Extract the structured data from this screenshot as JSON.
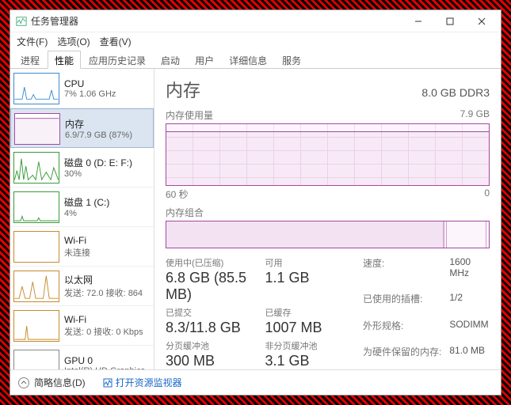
{
  "window": {
    "title": "任务管理器"
  },
  "menu": {
    "file": "文件(F)",
    "options": "选项(O)",
    "view": "查看(V)"
  },
  "tabs": {
    "processes": "进程",
    "performance": "性能",
    "app_history": "应用历史记录",
    "startup": "启动",
    "users": "用户",
    "details": "详细信息",
    "services": "服务"
  },
  "sidebar": {
    "items": [
      {
        "name": "CPU",
        "sub": "7%  1.06 GHz",
        "kind": "cpu"
      },
      {
        "name": "内存",
        "sub": "6.9/7.9 GB (87%)",
        "kind": "memory",
        "selected": true
      },
      {
        "name": "磁盘 0 (D: E: F:)",
        "sub": "30%",
        "kind": "disk0"
      },
      {
        "name": "磁盘 1 (C:)",
        "sub": "4%",
        "kind": "disk1"
      },
      {
        "name": "Wi-Fi",
        "sub": "未连接",
        "kind": "wifi0"
      },
      {
        "name": "以太网",
        "sub": "发送: 72.0 接收: 864",
        "kind": "eth"
      },
      {
        "name": "Wi-Fi",
        "sub": "发送: 0 接收: 0 Kbps",
        "kind": "wifi1"
      },
      {
        "name": "GPU 0",
        "sub": "Intel(R) HD Graphics",
        "kind": "gpu"
      }
    ]
  },
  "main": {
    "title": "内存",
    "subtitle": "8.0 GB DDR3",
    "usage_label": "内存使用量",
    "usage_max": "7.9 GB",
    "x_left": "60 秒",
    "x_right": "0",
    "composition_label": "内存组合"
  },
  "stats": {
    "in_use_label": "使用中(已压缩)",
    "in_use_val": "6.8 GB (85.5 MB)",
    "avail_label": "可用",
    "avail_val": "1.1 GB",
    "commit_label": "已提交",
    "commit_val": "8.3/11.8 GB",
    "cached_label": "已缓存",
    "cached_val": "1007 MB",
    "paged_label": "分页缓冲池",
    "paged_val": "300 MB",
    "nonpaged_label": "非分页缓冲池",
    "nonpaged_val": "3.1 GB"
  },
  "details": {
    "speed_label": "速度:",
    "speed_val": "1600 MHz",
    "slots_label": "已使用的插槽:",
    "slots_val": "1/2",
    "form_label": "外形规格:",
    "form_val": "SODIMM",
    "reserved_label": "为硬件保留的内存:",
    "reserved_val": "81.0 MB"
  },
  "footer": {
    "fewer": "简略信息(D)",
    "resmon": "打开资源监视器"
  },
  "chart_data": {
    "type": "line",
    "title": "内存使用量",
    "xlabel": "60 秒 → 0",
    "ylabel": "GB",
    "ylim": [
      0,
      7.9
    ],
    "x": [
      60,
      55,
      50,
      45,
      40,
      35,
      30,
      25,
      20,
      15,
      10,
      5,
      0
    ],
    "values": [
      6.9,
      6.9,
      6.9,
      6.9,
      6.9,
      6.9,
      6.9,
      6.9,
      6.9,
      6.9,
      6.9,
      6.9,
      6.9
    ],
    "composition": {
      "type": "bar",
      "total_gb": 7.9,
      "segments": [
        {
          "name": "in_use",
          "gb": 6.8
        },
        {
          "name": "modified",
          "gb": 0.05
        },
        {
          "name": "standby",
          "gb": 1.0
        },
        {
          "name": "free",
          "gb": 0.05
        }
      ]
    }
  }
}
